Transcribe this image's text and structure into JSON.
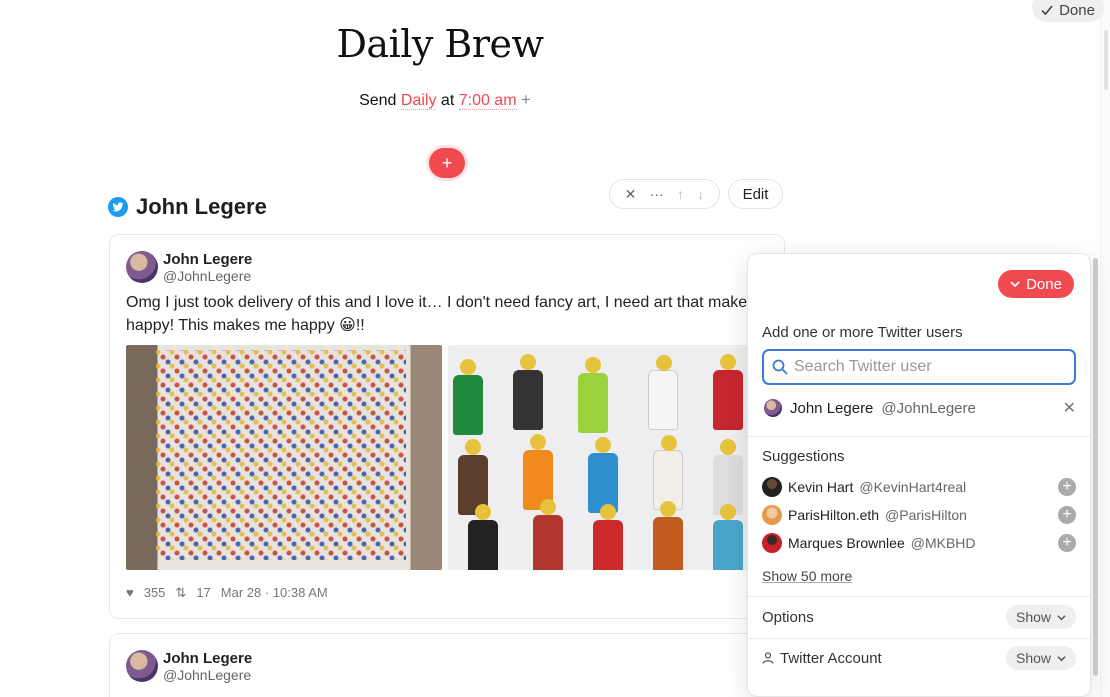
{
  "header": {
    "done_label": "Done",
    "title": "Daily Brew",
    "send_prefix": "Send",
    "frequency": "Daily",
    "at": "at",
    "time": "7:00 am",
    "add_plus": "+"
  },
  "block": {
    "add_label": "+",
    "edit_label": "Edit",
    "section_name": "John Legere"
  },
  "tweets": [
    {
      "name": "John Legere",
      "handle": "@JohnLegere",
      "text_line1": "Omg I just took delivery of this and I love it… I don't need fancy art, I need art that makes me",
      "text_line2": "happy! This makes me happy 😀!!",
      "likes": "355",
      "retweets": "17",
      "date": "Mar 28 · 10:38 AM"
    },
    {
      "name": "John Legere",
      "handle": "@JohnLegere"
    }
  ],
  "panel": {
    "done_label": "Done",
    "add_label": "Add one or more Twitter users",
    "search_placeholder": "Search Twitter user",
    "selected": {
      "name": "John Legere",
      "handle": "@JohnLegere"
    },
    "suggestions_label": "Suggestions",
    "suggestions": [
      {
        "name": "Kevin Hart",
        "handle": "@KevinHart4real"
      },
      {
        "name": "ParisHilton.eth",
        "handle": "@ParisHilton"
      },
      {
        "name": "Marques Brownlee",
        "handle": "@MKBHD"
      }
    ],
    "show_more": "Show 50 more",
    "options_label": "Options",
    "options_show": "Show",
    "account_label": "Twitter Account",
    "account_show": "Show"
  },
  "colors": {
    "accent": "#f0494f",
    "twitter_blue": "#1d9bf0",
    "focus_blue": "#3a7bd5"
  }
}
